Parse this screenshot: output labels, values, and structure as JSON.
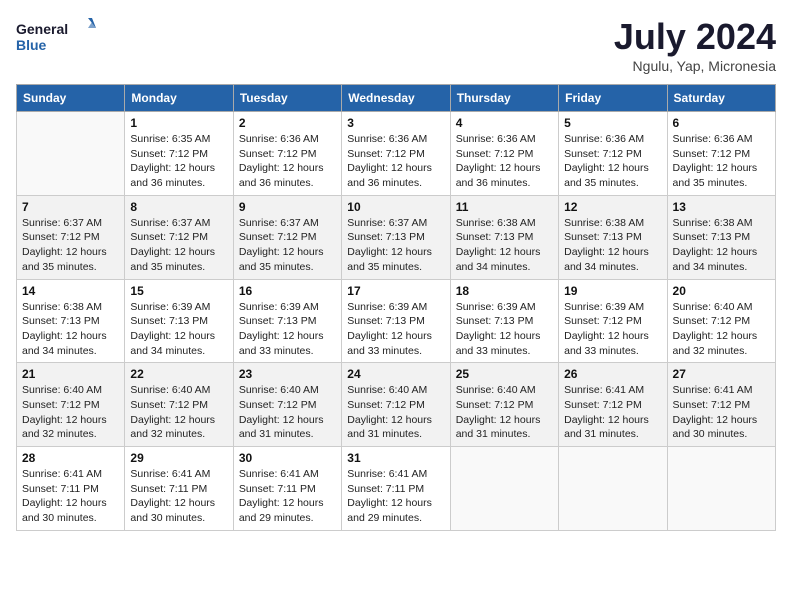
{
  "header": {
    "logo_line1": "General",
    "logo_line2": "Blue",
    "month_title": "July 2024",
    "location": "Ngulu, Yap, Micronesia"
  },
  "days_of_week": [
    "Sunday",
    "Monday",
    "Tuesday",
    "Wednesday",
    "Thursday",
    "Friday",
    "Saturday"
  ],
  "weeks": [
    [
      {
        "day": "",
        "sunrise": "",
        "sunset": "",
        "daylight": ""
      },
      {
        "day": "1",
        "sunrise": "Sunrise: 6:35 AM",
        "sunset": "Sunset: 7:12 PM",
        "daylight": "Daylight: 12 hours and 36 minutes."
      },
      {
        "day": "2",
        "sunrise": "Sunrise: 6:36 AM",
        "sunset": "Sunset: 7:12 PM",
        "daylight": "Daylight: 12 hours and 36 minutes."
      },
      {
        "day": "3",
        "sunrise": "Sunrise: 6:36 AM",
        "sunset": "Sunset: 7:12 PM",
        "daylight": "Daylight: 12 hours and 36 minutes."
      },
      {
        "day": "4",
        "sunrise": "Sunrise: 6:36 AM",
        "sunset": "Sunset: 7:12 PM",
        "daylight": "Daylight: 12 hours and 36 minutes."
      },
      {
        "day": "5",
        "sunrise": "Sunrise: 6:36 AM",
        "sunset": "Sunset: 7:12 PM",
        "daylight": "Daylight: 12 hours and 35 minutes."
      },
      {
        "day": "6",
        "sunrise": "Sunrise: 6:36 AM",
        "sunset": "Sunset: 7:12 PM",
        "daylight": "Daylight: 12 hours and 35 minutes."
      }
    ],
    [
      {
        "day": "7",
        "sunrise": "Sunrise: 6:37 AM",
        "sunset": "Sunset: 7:12 PM",
        "daylight": "Daylight: 12 hours and 35 minutes."
      },
      {
        "day": "8",
        "sunrise": "Sunrise: 6:37 AM",
        "sunset": "Sunset: 7:12 PM",
        "daylight": "Daylight: 12 hours and 35 minutes."
      },
      {
        "day": "9",
        "sunrise": "Sunrise: 6:37 AM",
        "sunset": "Sunset: 7:12 PM",
        "daylight": "Daylight: 12 hours and 35 minutes."
      },
      {
        "day": "10",
        "sunrise": "Sunrise: 6:37 AM",
        "sunset": "Sunset: 7:13 PM",
        "daylight": "Daylight: 12 hours and 35 minutes."
      },
      {
        "day": "11",
        "sunrise": "Sunrise: 6:38 AM",
        "sunset": "Sunset: 7:13 PM",
        "daylight": "Daylight: 12 hours and 34 minutes."
      },
      {
        "day": "12",
        "sunrise": "Sunrise: 6:38 AM",
        "sunset": "Sunset: 7:13 PM",
        "daylight": "Daylight: 12 hours and 34 minutes."
      },
      {
        "day": "13",
        "sunrise": "Sunrise: 6:38 AM",
        "sunset": "Sunset: 7:13 PM",
        "daylight": "Daylight: 12 hours and 34 minutes."
      }
    ],
    [
      {
        "day": "14",
        "sunrise": "Sunrise: 6:38 AM",
        "sunset": "Sunset: 7:13 PM",
        "daylight": "Daylight: 12 hours and 34 minutes."
      },
      {
        "day": "15",
        "sunrise": "Sunrise: 6:39 AM",
        "sunset": "Sunset: 7:13 PM",
        "daylight": "Daylight: 12 hours and 34 minutes."
      },
      {
        "day": "16",
        "sunrise": "Sunrise: 6:39 AM",
        "sunset": "Sunset: 7:13 PM",
        "daylight": "Daylight: 12 hours and 33 minutes."
      },
      {
        "day": "17",
        "sunrise": "Sunrise: 6:39 AM",
        "sunset": "Sunset: 7:13 PM",
        "daylight": "Daylight: 12 hours and 33 minutes."
      },
      {
        "day": "18",
        "sunrise": "Sunrise: 6:39 AM",
        "sunset": "Sunset: 7:13 PM",
        "daylight": "Daylight: 12 hours and 33 minutes."
      },
      {
        "day": "19",
        "sunrise": "Sunrise: 6:39 AM",
        "sunset": "Sunset: 7:12 PM",
        "daylight": "Daylight: 12 hours and 33 minutes."
      },
      {
        "day": "20",
        "sunrise": "Sunrise: 6:40 AM",
        "sunset": "Sunset: 7:12 PM",
        "daylight": "Daylight: 12 hours and 32 minutes."
      }
    ],
    [
      {
        "day": "21",
        "sunrise": "Sunrise: 6:40 AM",
        "sunset": "Sunset: 7:12 PM",
        "daylight": "Daylight: 12 hours and 32 minutes."
      },
      {
        "day": "22",
        "sunrise": "Sunrise: 6:40 AM",
        "sunset": "Sunset: 7:12 PM",
        "daylight": "Daylight: 12 hours and 32 minutes."
      },
      {
        "day": "23",
        "sunrise": "Sunrise: 6:40 AM",
        "sunset": "Sunset: 7:12 PM",
        "daylight": "Daylight: 12 hours and 31 minutes."
      },
      {
        "day": "24",
        "sunrise": "Sunrise: 6:40 AM",
        "sunset": "Sunset: 7:12 PM",
        "daylight": "Daylight: 12 hours and 31 minutes."
      },
      {
        "day": "25",
        "sunrise": "Sunrise: 6:40 AM",
        "sunset": "Sunset: 7:12 PM",
        "daylight": "Daylight: 12 hours and 31 minutes."
      },
      {
        "day": "26",
        "sunrise": "Sunrise: 6:41 AM",
        "sunset": "Sunset: 7:12 PM",
        "daylight": "Daylight: 12 hours and 31 minutes."
      },
      {
        "day": "27",
        "sunrise": "Sunrise: 6:41 AM",
        "sunset": "Sunset: 7:12 PM",
        "daylight": "Daylight: 12 hours and 30 minutes."
      }
    ],
    [
      {
        "day": "28",
        "sunrise": "Sunrise: 6:41 AM",
        "sunset": "Sunset: 7:11 PM",
        "daylight": "Daylight: 12 hours and 30 minutes."
      },
      {
        "day": "29",
        "sunrise": "Sunrise: 6:41 AM",
        "sunset": "Sunset: 7:11 PM",
        "daylight": "Daylight: 12 hours and 30 minutes."
      },
      {
        "day": "30",
        "sunrise": "Sunrise: 6:41 AM",
        "sunset": "Sunset: 7:11 PM",
        "daylight": "Daylight: 12 hours and 29 minutes."
      },
      {
        "day": "31",
        "sunrise": "Sunrise: 6:41 AM",
        "sunset": "Sunset: 7:11 PM",
        "daylight": "Daylight: 12 hours and 29 minutes."
      },
      {
        "day": "",
        "sunrise": "",
        "sunset": "",
        "daylight": ""
      },
      {
        "day": "",
        "sunrise": "",
        "sunset": "",
        "daylight": ""
      },
      {
        "day": "",
        "sunrise": "",
        "sunset": "",
        "daylight": ""
      }
    ]
  ]
}
